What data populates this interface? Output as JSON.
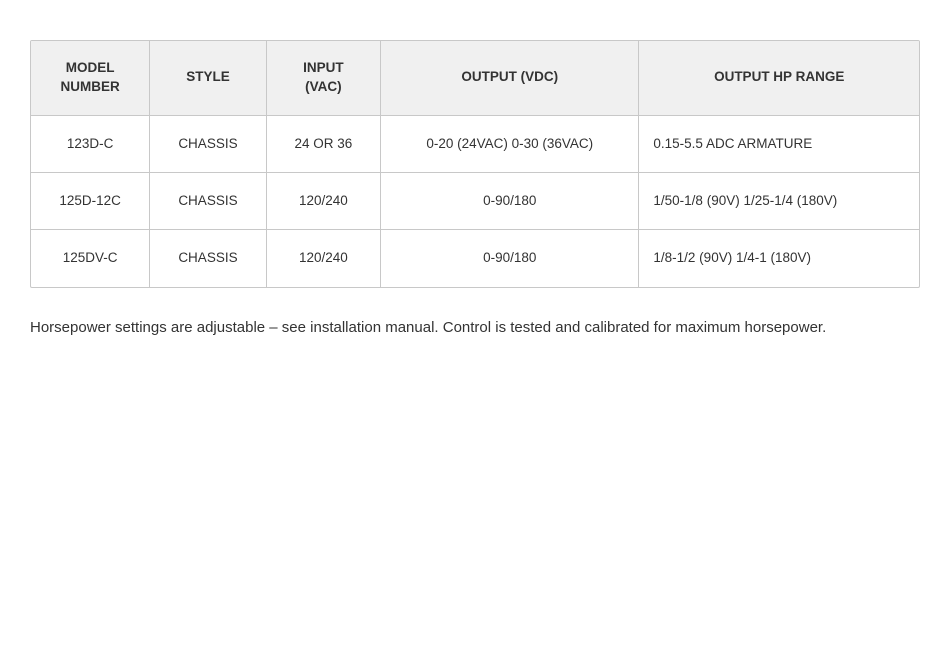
{
  "table": {
    "headers": [
      {
        "id": "model-number",
        "label": "MODEL\nNUMBER"
      },
      {
        "id": "style",
        "label": "STYLE"
      },
      {
        "id": "input-vac",
        "label": "INPUT\n(VAC)"
      },
      {
        "id": "output-vdc",
        "label": "OUTPUT (VDC)"
      },
      {
        "id": "output-hp-range",
        "label": "OUTPUT HP RANGE"
      }
    ],
    "rows": [
      {
        "model": "123D-C",
        "style": "CHASSIS",
        "input": "24 OR 36",
        "output_vdc": "0-20 (24VAC) 0-30 (36VAC)",
        "output_hp": "0.15-5.5 ADC ARMATURE"
      },
      {
        "model": "125D-12C",
        "style": "CHASSIS",
        "input": "120/240",
        "output_vdc": "0-90/180",
        "output_hp": "1/50-1/8 (90V) 1/25-1/4 (180V)"
      },
      {
        "model": "125DV-C",
        "style": "CHASSIS",
        "input": "120/240",
        "output_vdc": "0-90/180",
        "output_hp": "1/8-1/2 (90V) 1/4-1 (180V)"
      }
    ]
  },
  "footnote": "Horsepower settings are adjustable – see installation manual. Control is tested and calibrated for maximum horsepower."
}
